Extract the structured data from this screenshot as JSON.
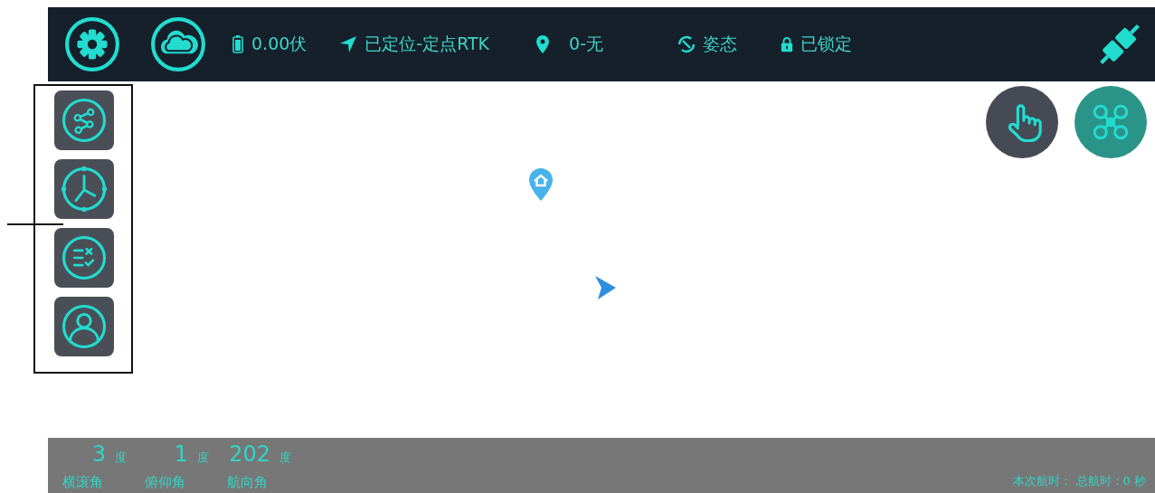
{
  "status_bar": [
    {
      "kind": "battery",
      "text": "0.00伏"
    },
    {
      "kind": "locate",
      "text": "已定位-定点RTK"
    },
    {
      "kind": "pin",
      "text": "0-无"
    },
    {
      "kind": "attitude",
      "text": "姿态"
    },
    {
      "kind": "lock",
      "text": "已锁定"
    }
  ],
  "attitude": [
    {
      "value": "3",
      "unit": "度",
      "label": "横滚角"
    },
    {
      "value": "1",
      "unit": "度",
      "label": "俯仰角"
    },
    {
      "value": "202",
      "unit": "度",
      "label": "航向角"
    }
  ],
  "flight_time": "本次航时： 总航时：0 秒"
}
